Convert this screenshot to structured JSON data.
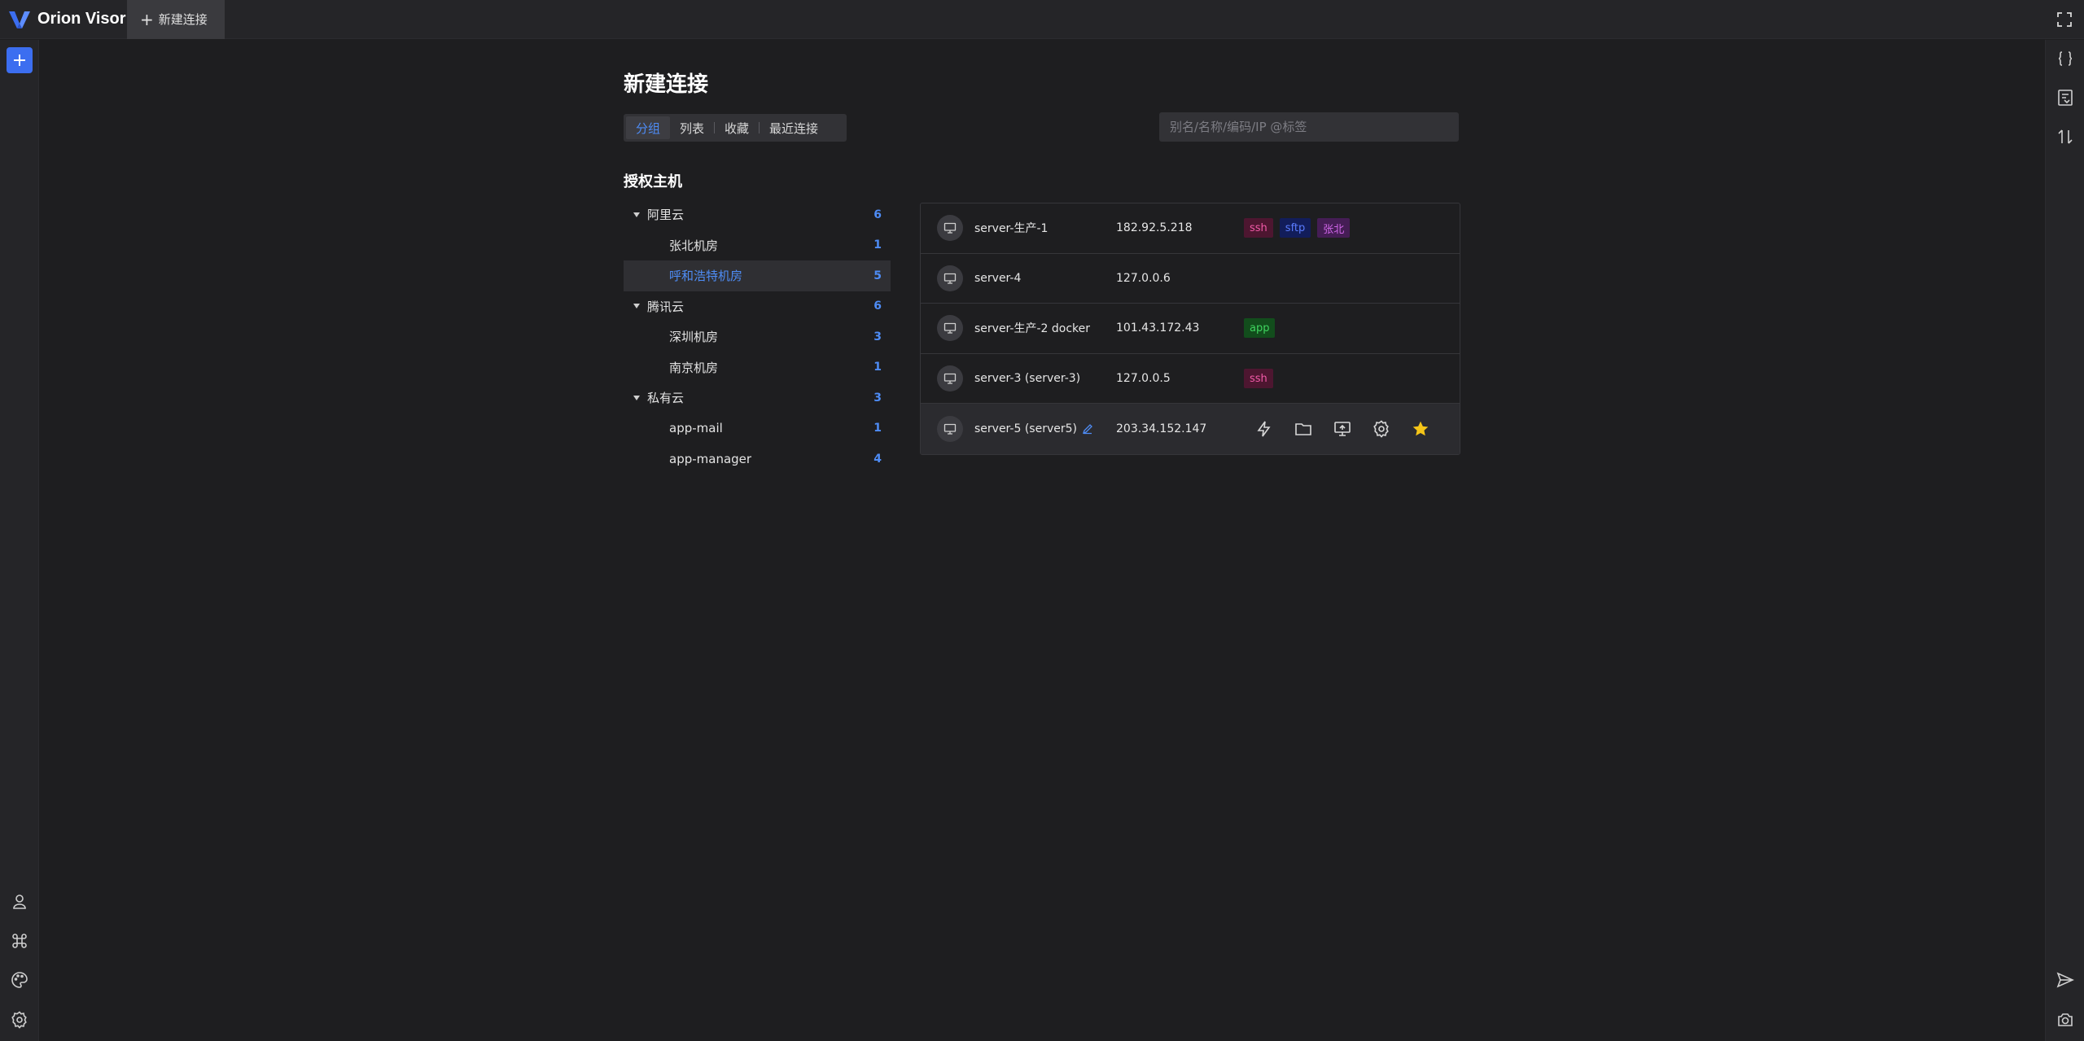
{
  "app": {
    "name": "Orion Visor"
  },
  "tabs": [
    {
      "label": "新建连接"
    }
  ],
  "page": {
    "title": "新建连接",
    "view_modes": [
      "分组",
      "列表",
      "收藏",
      "最近连接"
    ],
    "active_view": "分组",
    "search_placeholder": "别名/名称/编码/IP @标签",
    "section_title": "授权主机"
  },
  "tree": [
    {
      "label": "阿里云",
      "count": "6",
      "level": 0
    },
    {
      "label": "张北机房",
      "count": "1",
      "level": 1
    },
    {
      "label": "呼和浩特机房",
      "count": "5",
      "level": 1,
      "selected": true
    },
    {
      "label": "腾讯云",
      "count": "6",
      "level": 0
    },
    {
      "label": "深圳机房",
      "count": "3",
      "level": 1
    },
    {
      "label": "南京机房",
      "count": "1",
      "level": 1
    },
    {
      "label": "私有云",
      "count": "3",
      "level": 0
    },
    {
      "label": "app-mail",
      "count": "1",
      "level": 1
    },
    {
      "label": "app-manager",
      "count": "4",
      "level": 1
    }
  ],
  "hosts": [
    {
      "name": "server-生产-1",
      "ip": "182.92.5.218",
      "tags": [
        {
          "label": "ssh",
          "color": "#f25aa8",
          "bg": "#4d1630"
        },
        {
          "label": "sftp",
          "color": "#5a7cff",
          "bg": "#121d5a"
        },
        {
          "label": "张北",
          "color": "#d066e8",
          "bg": "#451d55"
        }
      ]
    },
    {
      "name": "server-4",
      "ip": "127.0.0.6",
      "tags": []
    },
    {
      "name": "server-生产-2  docker",
      "ip": "101.43.172.43",
      "tags": [
        {
          "label": "app",
          "color": "#3fd45f",
          "bg": "#124d1c"
        }
      ]
    },
    {
      "name": "server-3 (server-3)",
      "ip": "127.0.0.5",
      "tags": [
        {
          "label": "ssh",
          "color": "#f25aa8",
          "bg": "#4d1630"
        }
      ]
    },
    {
      "name": "server-5 (server5)",
      "ip": "203.34.152.147",
      "tags": [],
      "hovered": true,
      "actions": [
        "lightning-icon",
        "folder-icon",
        "monitor-share-icon",
        "settings-icon",
        "star-icon"
      ]
    }
  ],
  "colors": {
    "accent": "#4e8cf5",
    "favorite": "#f5c518",
    "new_button": "#3c6ef0"
  },
  "icons": {
    "top_right": "fullscreen-icon",
    "right_sidebar": [
      "braces-icon",
      "snippet-icon",
      "transfer-icon",
      "send-icon",
      "screenshot-icon"
    ],
    "left_sidebar": [
      "plus-icon",
      "user-icon",
      "command-icon",
      "palette-icon",
      "settings-icon"
    ]
  }
}
